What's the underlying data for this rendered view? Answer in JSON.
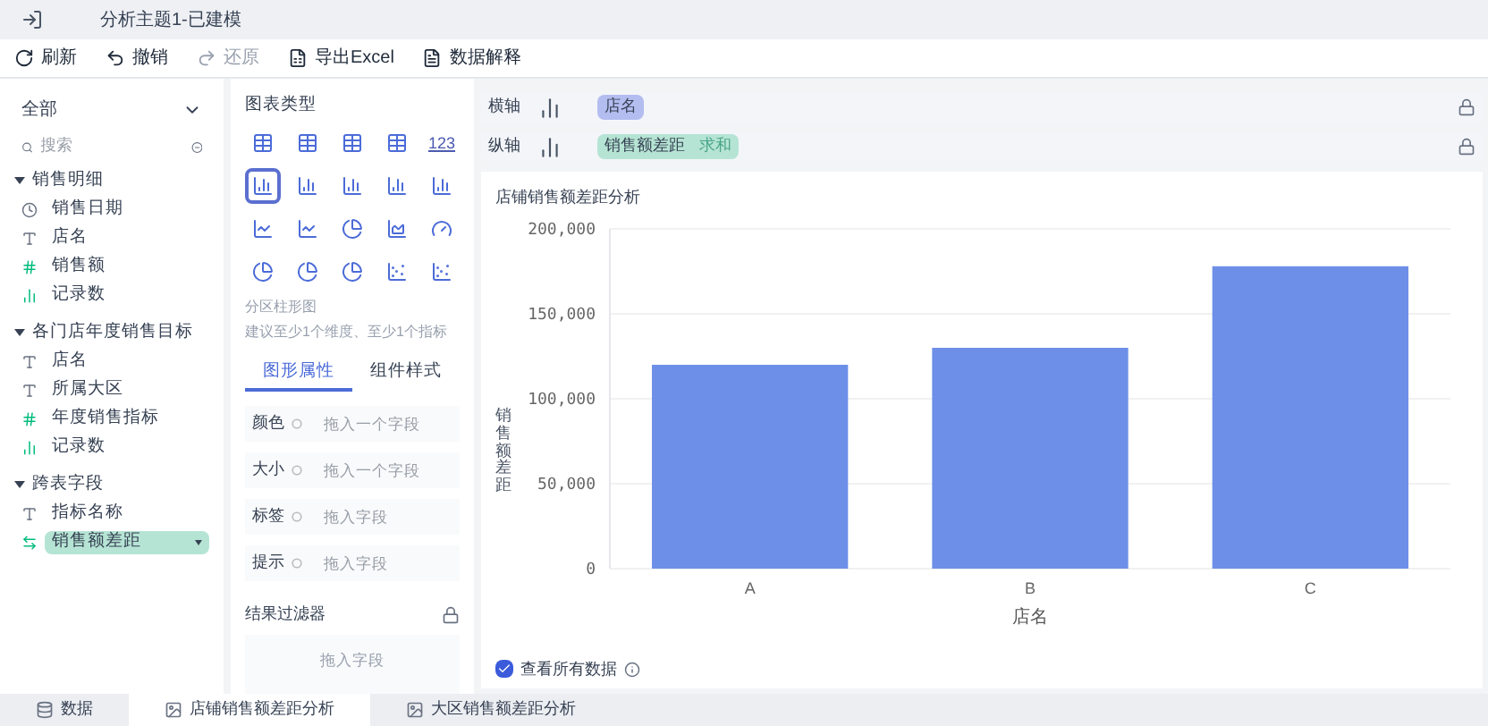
{
  "window": {
    "title": "分析主题1-已建模"
  },
  "toolbar": [
    {
      "label": "刷新",
      "kind": "refresh",
      "disabled": false
    },
    {
      "label": "撤销",
      "kind": "undo",
      "disabled": false
    },
    {
      "label": "还原",
      "kind": "redo",
      "disabled": true
    },
    {
      "label": "导出Excel",
      "kind": "export",
      "disabled": false
    },
    {
      "label": "数据解释",
      "kind": "explain",
      "disabled": false
    }
  ],
  "fields": {
    "scope": "全部",
    "search_placeholder": "搜索",
    "groups": [
      {
        "name": "销售明细",
        "expanded": true,
        "children": [
          {
            "name": "销售日期",
            "kind": "date",
            "selected": false
          },
          {
            "name": "店名",
            "kind": "text",
            "selected": false
          },
          {
            "name": "销售额",
            "kind": "measure",
            "selected": false
          },
          {
            "name": "记录数",
            "kind": "count",
            "selected": false
          }
        ]
      },
      {
        "name": "各门店年度销售目标",
        "expanded": true,
        "children": [
          {
            "name": "店名",
            "kind": "text",
            "selected": false
          },
          {
            "name": "所属大区",
            "kind": "text",
            "selected": false
          },
          {
            "name": "年度销售指标",
            "kind": "measure",
            "selected": false
          },
          {
            "name": "记录数",
            "kind": "count",
            "selected": false
          }
        ]
      },
      {
        "name": "跨表字段",
        "expanded": true,
        "children": [
          {
            "name": "指标名称",
            "kind": "text",
            "selected": false
          },
          {
            "name": "销售额差距",
            "kind": "cross",
            "selected": true
          }
        ]
      }
    ]
  },
  "chart_types": {
    "title": "图表类型",
    "items": [
      {
        "kind": "table",
        "selected": false
      },
      {
        "kind": "table",
        "selected": false
      },
      {
        "kind": "table",
        "selected": false
      },
      {
        "kind": "table",
        "selected": false
      },
      {
        "kind": "number",
        "glyph": "123",
        "selected": false
      },
      {
        "kind": "bar",
        "selected": true
      },
      {
        "kind": "bar",
        "selected": false
      },
      {
        "kind": "bar",
        "selected": false
      },
      {
        "kind": "bar",
        "selected": false
      },
      {
        "kind": "bar",
        "selected": false
      },
      {
        "kind": "line",
        "selected": false
      },
      {
        "kind": "line",
        "selected": false
      },
      {
        "kind": "pie",
        "selected": false
      },
      {
        "kind": "area",
        "selected": false
      },
      {
        "kind": "gauge",
        "selected": false
      },
      {
        "kind": "pie",
        "selected": false
      },
      {
        "kind": "pie",
        "selected": false
      },
      {
        "kind": "pie",
        "selected": false
      },
      {
        "kind": "scatter",
        "selected": false
      },
      {
        "kind": "scatter",
        "selected": false
      }
    ],
    "name": "分区柱形图",
    "hint": "建议至少1个维度、至少1个指标"
  },
  "property_tabs": [
    {
      "label": "图形属性",
      "selected": true
    },
    {
      "label": "组件样式",
      "selected": false
    }
  ],
  "properties": [
    {
      "label": "颜色",
      "placeholder": "拖入一个字段"
    },
    {
      "label": "大小",
      "placeholder": "拖入一个字段"
    },
    {
      "label": "标签",
      "placeholder": "拖入字段"
    },
    {
      "label": "提示",
      "placeholder": "拖入字段"
    }
  ],
  "filter": {
    "title": "结果过滤器",
    "placeholder": "拖入字段"
  },
  "axes": [
    {
      "label": "横轴",
      "field": "店名",
      "kind": "dimension"
    },
    {
      "label": "纵轴",
      "field": "销售额差距",
      "aggregation": "求和",
      "kind": "measure"
    }
  ],
  "chart": {
    "title": "店铺销售额差距分析",
    "show_all": {
      "label": "查看所有数据",
      "checked": true
    },
    "chart_data": {
      "type": "bar",
      "xlabel": "店名",
      "ylabel": "销售额差距",
      "categories": [
        "A",
        "B",
        "C"
      ],
      "grid": true,
      "series": [
        {
          "color": "#6e8fe8",
          "values": [
            120000,
            130000,
            178000
          ]
        }
      ],
      "ylim": [
        0,
        200000
      ],
      "yticks": [
        {
          "value": 0,
          "label": "0"
        },
        {
          "value": 50000,
          "label": "50,000"
        },
        {
          "value": 100000,
          "label": "100,000"
        },
        {
          "value": 150000,
          "label": "150,000"
        },
        {
          "value": 200000,
          "label": "200,000"
        }
      ]
    }
  },
  "bottom_tabs": [
    {
      "label": "数据",
      "kind": "data",
      "selected": false
    },
    {
      "label": "店铺销售额差距分析",
      "kind": "sheet",
      "selected": true
    },
    {
      "label": "大区销售额差距分析",
      "kind": "sheet",
      "selected": false
    }
  ]
}
